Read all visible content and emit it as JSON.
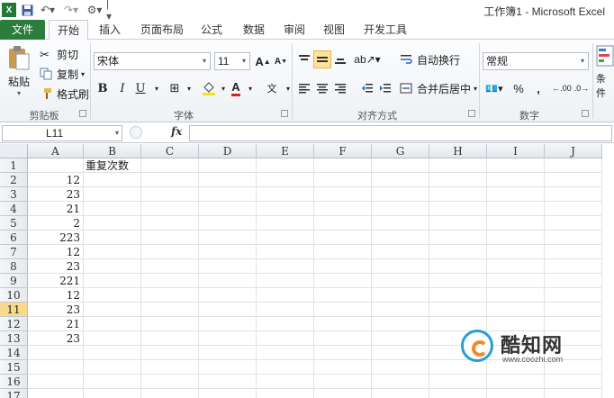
{
  "window": {
    "title": "工作簿1 - Microsoft Excel"
  },
  "tabs": [
    {
      "label": "文件"
    },
    {
      "label": "开始"
    },
    {
      "label": "插入"
    },
    {
      "label": "页面布局"
    },
    {
      "label": "公式"
    },
    {
      "label": "数据"
    },
    {
      "label": "审阅"
    },
    {
      "label": "视图"
    },
    {
      "label": "开发工具"
    }
  ],
  "ribbon": {
    "clipboard": {
      "paste": "粘贴",
      "cut": "剪切",
      "copy": "复制",
      "format_painter": "格式刷",
      "label": "剪贴板"
    },
    "font": {
      "name": "宋体",
      "size": "11",
      "label": "字体",
      "grow": "A",
      "shrink": "A",
      "bold": "B",
      "italic": "I",
      "underline": "U",
      "phonetic": "wén"
    },
    "alignment": {
      "wrap": "自动换行",
      "merge": "合并后居中",
      "label": "对齐方式"
    },
    "number": {
      "format": "常规",
      "percent": "%",
      "comma": ",",
      "inc": ".00",
      "dec": ".0",
      "label": "数字"
    },
    "styles": {
      "conditional": "条件"
    }
  },
  "formula_bar": {
    "name_box": "L11",
    "fx": "fx",
    "content": ""
  },
  "grid": {
    "columns": [
      "A",
      "B",
      "C",
      "D",
      "E",
      "F",
      "G",
      "H",
      "I",
      "J"
    ],
    "rows": [
      "1",
      "2",
      "3",
      "4",
      "5",
      "6",
      "7",
      "8",
      "9",
      "10",
      "11",
      "12",
      "13",
      "14",
      "15",
      "16",
      "17"
    ],
    "selected_row": "11",
    "cells": {
      "B1": "重复次数",
      "A2": "12",
      "A3": "23",
      "A4": "21",
      "A5": "2",
      "A6": "223",
      "A7": "12",
      "A8": "23",
      "A9": "221",
      "A10": "12",
      "A11": "23",
      "A12": "21",
      "A13": "23"
    }
  },
  "watermark": {
    "name": "酷知网",
    "url": "www.coozhi.com"
  },
  "colors": {
    "file_tab": "#2a7d3b",
    "selection": "#f9d98a",
    "accent_blue": "#2a9cd8",
    "accent_orange": "#f08a2b"
  }
}
